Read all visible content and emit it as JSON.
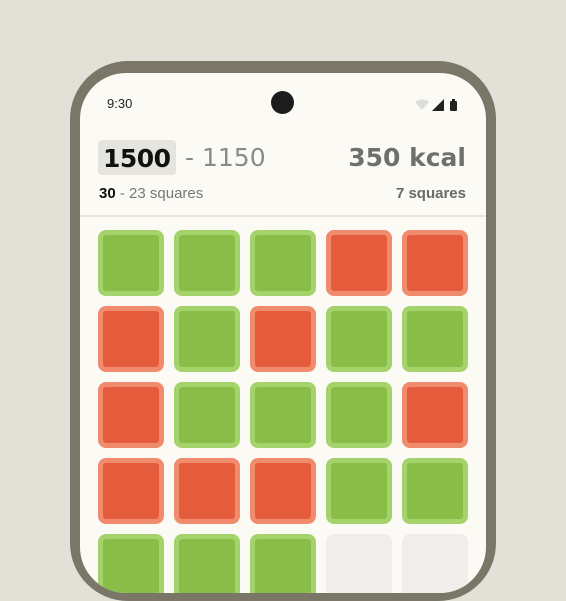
{
  "status_bar": {
    "time": "9:30"
  },
  "header": {
    "goal": "1500",
    "separator": "-",
    "remaining": "1150",
    "kcal": "350 kcal",
    "squares_goal": "30",
    "squares_separator": "-",
    "squares_remaining": "23 squares",
    "squares_used": "7 squares"
  },
  "colors": {
    "green": "#89bd48",
    "red": "#e45c3c",
    "empty": "#f0eeea",
    "phone_frame": "#7a7668",
    "background": "#e3e0d8"
  },
  "grid": {
    "rows": [
      [
        "green",
        "green",
        "green",
        "red",
        "red"
      ],
      [
        "red",
        "green",
        "red",
        "green",
        "green"
      ],
      [
        "red",
        "green",
        "green",
        "green",
        "red"
      ],
      [
        "red",
        "red",
        "red",
        "green",
        "green"
      ],
      [
        "green",
        "green",
        "green",
        "empty",
        "empty"
      ]
    ]
  }
}
